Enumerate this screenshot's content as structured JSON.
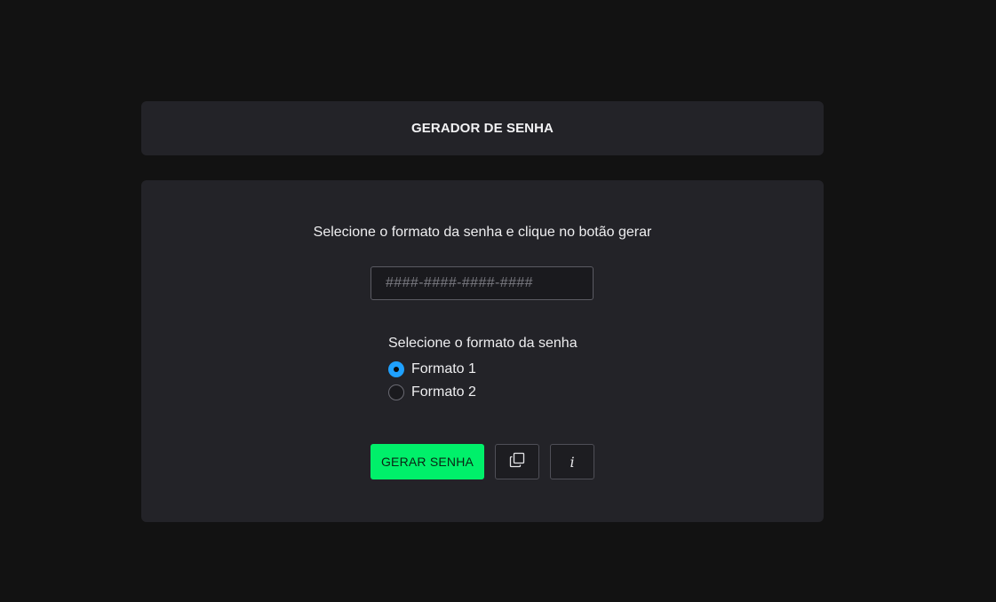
{
  "header": {
    "title": "GERADOR DE SENHA"
  },
  "main": {
    "instruction": "Selecione o formato da senha e clique no botão gerar",
    "password_input": {
      "value": "",
      "placeholder": "####-####-####-####"
    },
    "format_label": "Selecione o formato da senha",
    "formats": [
      {
        "label": "Formato 1",
        "checked": true
      },
      {
        "label": "Formato 2",
        "checked": false
      }
    ],
    "buttons": {
      "generate_label": "GERAR SENHA",
      "copy_icon": "copy-icon",
      "info_label": "i"
    }
  },
  "colors": {
    "background": "#121212",
    "card": "#232328",
    "accent_green": "#00f06a",
    "radio_blue": "#1fa1ff"
  }
}
